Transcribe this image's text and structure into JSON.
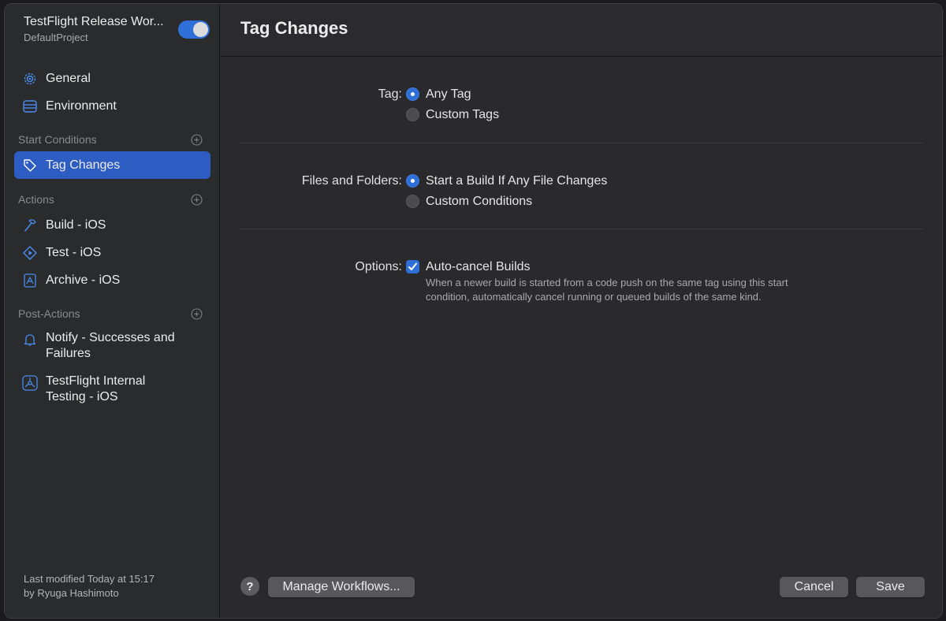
{
  "workflow": {
    "title": "TestFlight Release Wor...",
    "project": "DefaultProject",
    "enabled": true
  },
  "sidebar": {
    "top_items": [
      {
        "label": "General",
        "icon": "gear-icon"
      },
      {
        "label": "Environment",
        "icon": "environment-icon"
      }
    ],
    "sections": {
      "start_conditions": {
        "label": "Start Conditions",
        "items": [
          {
            "label": "Tag Changes",
            "icon": "tag-icon",
            "selected": true
          }
        ]
      },
      "actions": {
        "label": "Actions",
        "items": [
          {
            "label": "Build - iOS",
            "icon": "hammer-icon"
          },
          {
            "label": "Test - iOS",
            "icon": "play-diamond-icon"
          },
          {
            "label": "Archive - iOS",
            "icon": "archive-icon"
          }
        ]
      },
      "post_actions": {
        "label": "Post-Actions",
        "items": [
          {
            "label": "Notify - Successes and Failures",
            "icon": "bell-icon"
          },
          {
            "label": "TestFlight Internal Testing - iOS",
            "icon": "testflight-icon"
          }
        ]
      }
    },
    "footer": {
      "line1": "Last modified Today at 15:17",
      "line2": "by Ryuga Hashimoto"
    }
  },
  "main": {
    "title": "Tag Changes",
    "tag": {
      "label": "Tag:",
      "options": [
        "Any Tag",
        "Custom Tags"
      ],
      "selected": "Any Tag"
    },
    "files": {
      "label": "Files and Folders:",
      "options": [
        "Start a Build If Any File Changes",
        "Custom Conditions"
      ],
      "selected": "Start a Build If Any File Changes"
    },
    "options": {
      "label": "Options:",
      "checkbox_label": "Auto-cancel Builds",
      "checked": true,
      "help_line1": "When a newer build is started from a code push on the same tag using this start",
      "help_line2": "condition, automatically cancel running or queued builds of the same kind."
    }
  },
  "buttons": {
    "help": "?",
    "manage": "Manage Workflows...",
    "cancel": "Cancel",
    "save": "Save"
  },
  "colors": {
    "accent": "#2f6fd8",
    "selection": "#2d5cc2"
  }
}
